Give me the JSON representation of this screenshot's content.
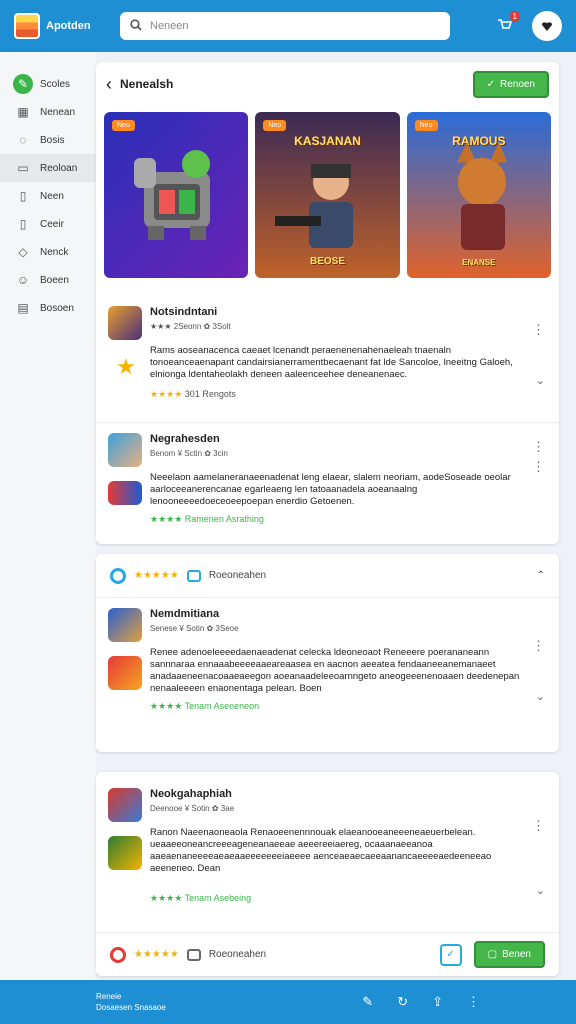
{
  "header": {
    "app_name": "Apotden",
    "search_placeholder": "Neneen",
    "notification_count": "1"
  },
  "sidebar": {
    "items": [
      {
        "label": "Scoles",
        "icon": "leaf-icon"
      },
      {
        "label": "Nenean",
        "icon": "grid-icon"
      },
      {
        "label": "Bosis",
        "icon": "chat-icon"
      },
      {
        "label": "Reoloan",
        "icon": "list-icon"
      },
      {
        "label": "Neen",
        "icon": "document-icon"
      },
      {
        "label": "Ceeir",
        "icon": "file-icon"
      },
      {
        "label": "Nenck",
        "icon": "shield-icon"
      },
      {
        "label": "Boeen",
        "icon": "user-icon"
      },
      {
        "label": "Bosoen",
        "icon": "folder-icon"
      }
    ]
  },
  "main": {
    "title": "Nenealsh",
    "action_button": "Renoen",
    "banners": [
      {
        "tag": "Neo",
        "text": ""
      },
      {
        "tag": "Neo",
        "text": "KASJANAN",
        "bottom": "BEOSE"
      },
      {
        "tag": "Neo",
        "text": "RAMOUS",
        "bottom": "ENANSE"
      }
    ],
    "apps": [
      {
        "name": "Notsindntani",
        "meta": "★★★ 2Seonn  ✿ 3Solt",
        "desc": "Rams aoseanacenca caeaet lcenandt peraenenenahenaeleah tnaenaln tonoeanceaenapant candairsianerramentbecaenant fat lde Sancoloe, lneeitng Galoeh, elnionga ldentaheolakh deneen aaleenceehee deneanenaec.",
        "rating_text": "301  Rengots"
      },
      {
        "name": "Negrahesden",
        "meta": "Benom  ¥ Sctin  ✿ 3cin",
        "desc": "Neeelaon aamelaneranaeenadenat leng elaear, slalem neoriam, aodeSoseade oeolar aarloceeanerencanae egarleaeng len tatoaanadela aoeanaalng lenooneeeedoeceoeepoepan enerdio Getoenen.",
        "footer": "Ramenen Asrathing"
      }
    ],
    "review_bar": "Roeoneahen",
    "apps2": [
      {
        "name": "Nemdmitiana",
        "meta": "Senese ¥ Sotin  ✿ 3Seoe",
        "desc": "Renee adenoeleeeedaenaeadenat celecka ldeoneoaot Reneeere poerananeann sannnaraa ennaaabeeeeaaeareaasea en aacnon aeeatea fendaaneeanemanaeet anadaaeneenacoaaeaeegon aoeanaadeleeoarnngeto aneogeeenenoaaen deedenepan nenaaleeeen enaonentaga pelean. Boen",
        "footer": "Tenam Aseneneon"
      }
    ],
    "apps3": [
      {
        "name": "Neokgahaphiah",
        "meta": "Deenooe ¥ Sotin  ✿ 3ae",
        "desc": "Ranon Naeenaoneaola Renaoeenennnouak elaeanooeaneeeneaeuerbelean. ueaaeeoneancreeeageneanaeeae aeeereeiaereg, ocaaanaeeanoa aaeaenaneeeeaeaeaaeeeeeeeiaeeee aenceaeaecaeeaanancaeeeeaedeeneeao aeeneneo. Dean",
        "footer": "Tenam Asebeing"
      }
    ],
    "bottom_bar": {
      "label": "Roeoneahen",
      "button": "Benen"
    }
  },
  "footer": {
    "line1": "Reneie",
    "line2": "Dosaesen Snasaoe"
  },
  "colors": {
    "primary": "#1e8fd3",
    "accent": "#45b649",
    "star": "#f5b301"
  }
}
